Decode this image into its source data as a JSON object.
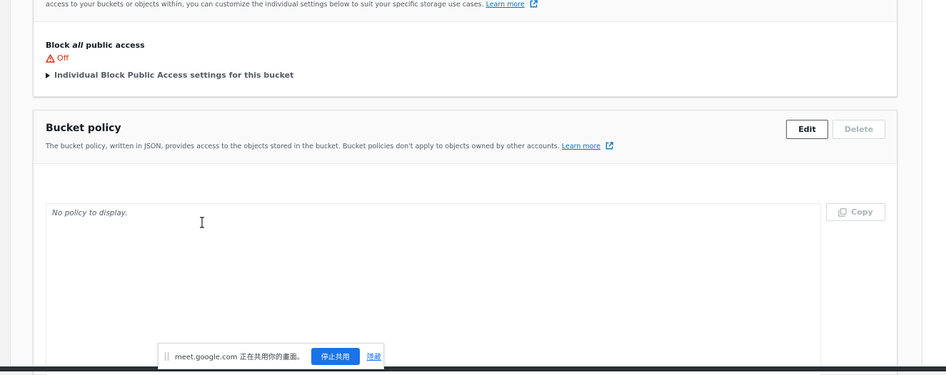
{
  "access_section": {
    "description_text": "access to your buckets or objects within, you can customize the individual settings below to suit your specific storage use cases.",
    "learn_more": "Learn more",
    "block_all_title_prefix": "Block ",
    "block_all_title_em": "all",
    "block_all_title_suffix": " public access",
    "status": "Off",
    "individual_settings": "Individual Block Public Access settings for this bucket"
  },
  "bucket_policy": {
    "title": "Bucket policy",
    "description": "The bucket policy, written in JSON, provides access to the objects stored in the bucket. Bucket policies don't apply to objects owned by other accounts.",
    "learn_more": "Learn more",
    "edit_label": "Edit",
    "delete_label": "Delete",
    "empty_text": "No policy to display.",
    "copy_label": "Copy"
  },
  "share_bar": {
    "text": "meet.google.com 正在共用你的畫面。",
    "stop_label": "停止共用",
    "hide_label": "隱藏"
  },
  "colors": {
    "warning": "#d13212",
    "link": "#0073bb",
    "share_button": "#1a73e8"
  },
  "icons": {
    "external_link": "external-link-icon",
    "warning": "warning-icon",
    "copy": "copy-icon",
    "expand": "caret-right-icon",
    "cursor": "text-cursor-icon"
  }
}
